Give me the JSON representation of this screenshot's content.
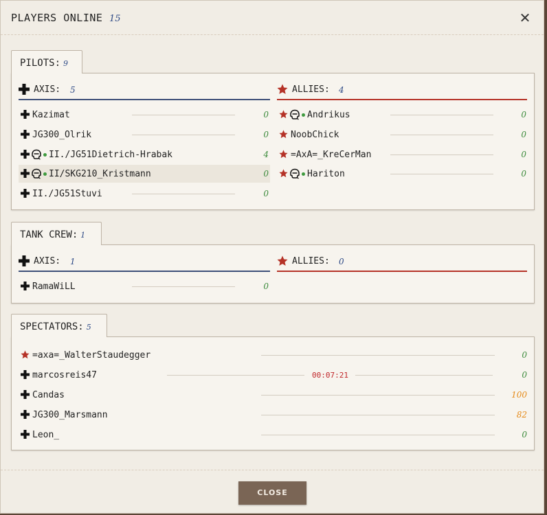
{
  "header": {
    "title": "PLAYERS ONLINE",
    "count": "15",
    "close_symbol": "✕"
  },
  "pilots": {
    "tab_label": "PILOTS:",
    "count": "9",
    "axis": {
      "label": "AXIS:",
      "count": "5"
    },
    "allies": {
      "label": "ALLIES:",
      "count": "4"
    },
    "axis_players": [
      {
        "name": "Kazimat",
        "score": "0",
        "pilot_icon": false
      },
      {
        "name": "JG300_Olrik",
        "score": "0",
        "pilot_icon": false
      },
      {
        "name": "II./JG51Dietrich-Hrabak",
        "score": "4",
        "pilot_icon": true
      },
      {
        "name": "II/SKG210_Kristmann",
        "score": "0",
        "pilot_icon": true
      },
      {
        "name": "II./JG51Stuvi",
        "score": "0",
        "pilot_icon": false
      }
    ],
    "allies_players": [
      {
        "name": "Andrikus",
        "score": "0",
        "pilot_icon": true
      },
      {
        "name": "NoobChick",
        "score": "0",
        "pilot_icon": false
      },
      {
        "name": "=AxA=_KreCerMan",
        "score": "0",
        "pilot_icon": false
      },
      {
        "name": "Hariton",
        "score": "0",
        "pilot_icon": true
      }
    ]
  },
  "tank_crew": {
    "tab_label": "TANK CREW:",
    "count": "1",
    "axis": {
      "label": "AXIS:",
      "count": "1"
    },
    "allies": {
      "label": "ALLIES:",
      "count": "0"
    },
    "axis_players": [
      {
        "name": "RamaWiLL",
        "score": "0"
      }
    ]
  },
  "spectators": {
    "tab_label": "SPECTATORS:",
    "count": "5",
    "players": [
      {
        "name": "=axa=_WalterStaudegger",
        "score": "0",
        "side": "allies",
        "timer": ""
      },
      {
        "name": "marcosreis47",
        "score": "0",
        "side": "axis",
        "timer": "00:07:21"
      },
      {
        "name": "Candas",
        "score": "100",
        "side": "axis",
        "timer": ""
      },
      {
        "name": "JG300_Marsmann",
        "score": "82",
        "side": "axis",
        "timer": ""
      },
      {
        "name": "Leon_",
        "score": "0",
        "side": "axis",
        "timer": ""
      }
    ]
  },
  "footer": {
    "close_label": "CLOSE"
  },
  "colors": {
    "axis": "#3d4f78",
    "allies": "#b53227",
    "score_green": "#3a8a3a",
    "score_orange": "#e58a19",
    "timer_red": "#c0262a"
  },
  "icons": {
    "axis": "balkenkreuz-icon",
    "allies": "red-star-icon",
    "pilot": "pilot-helmet-icon"
  }
}
